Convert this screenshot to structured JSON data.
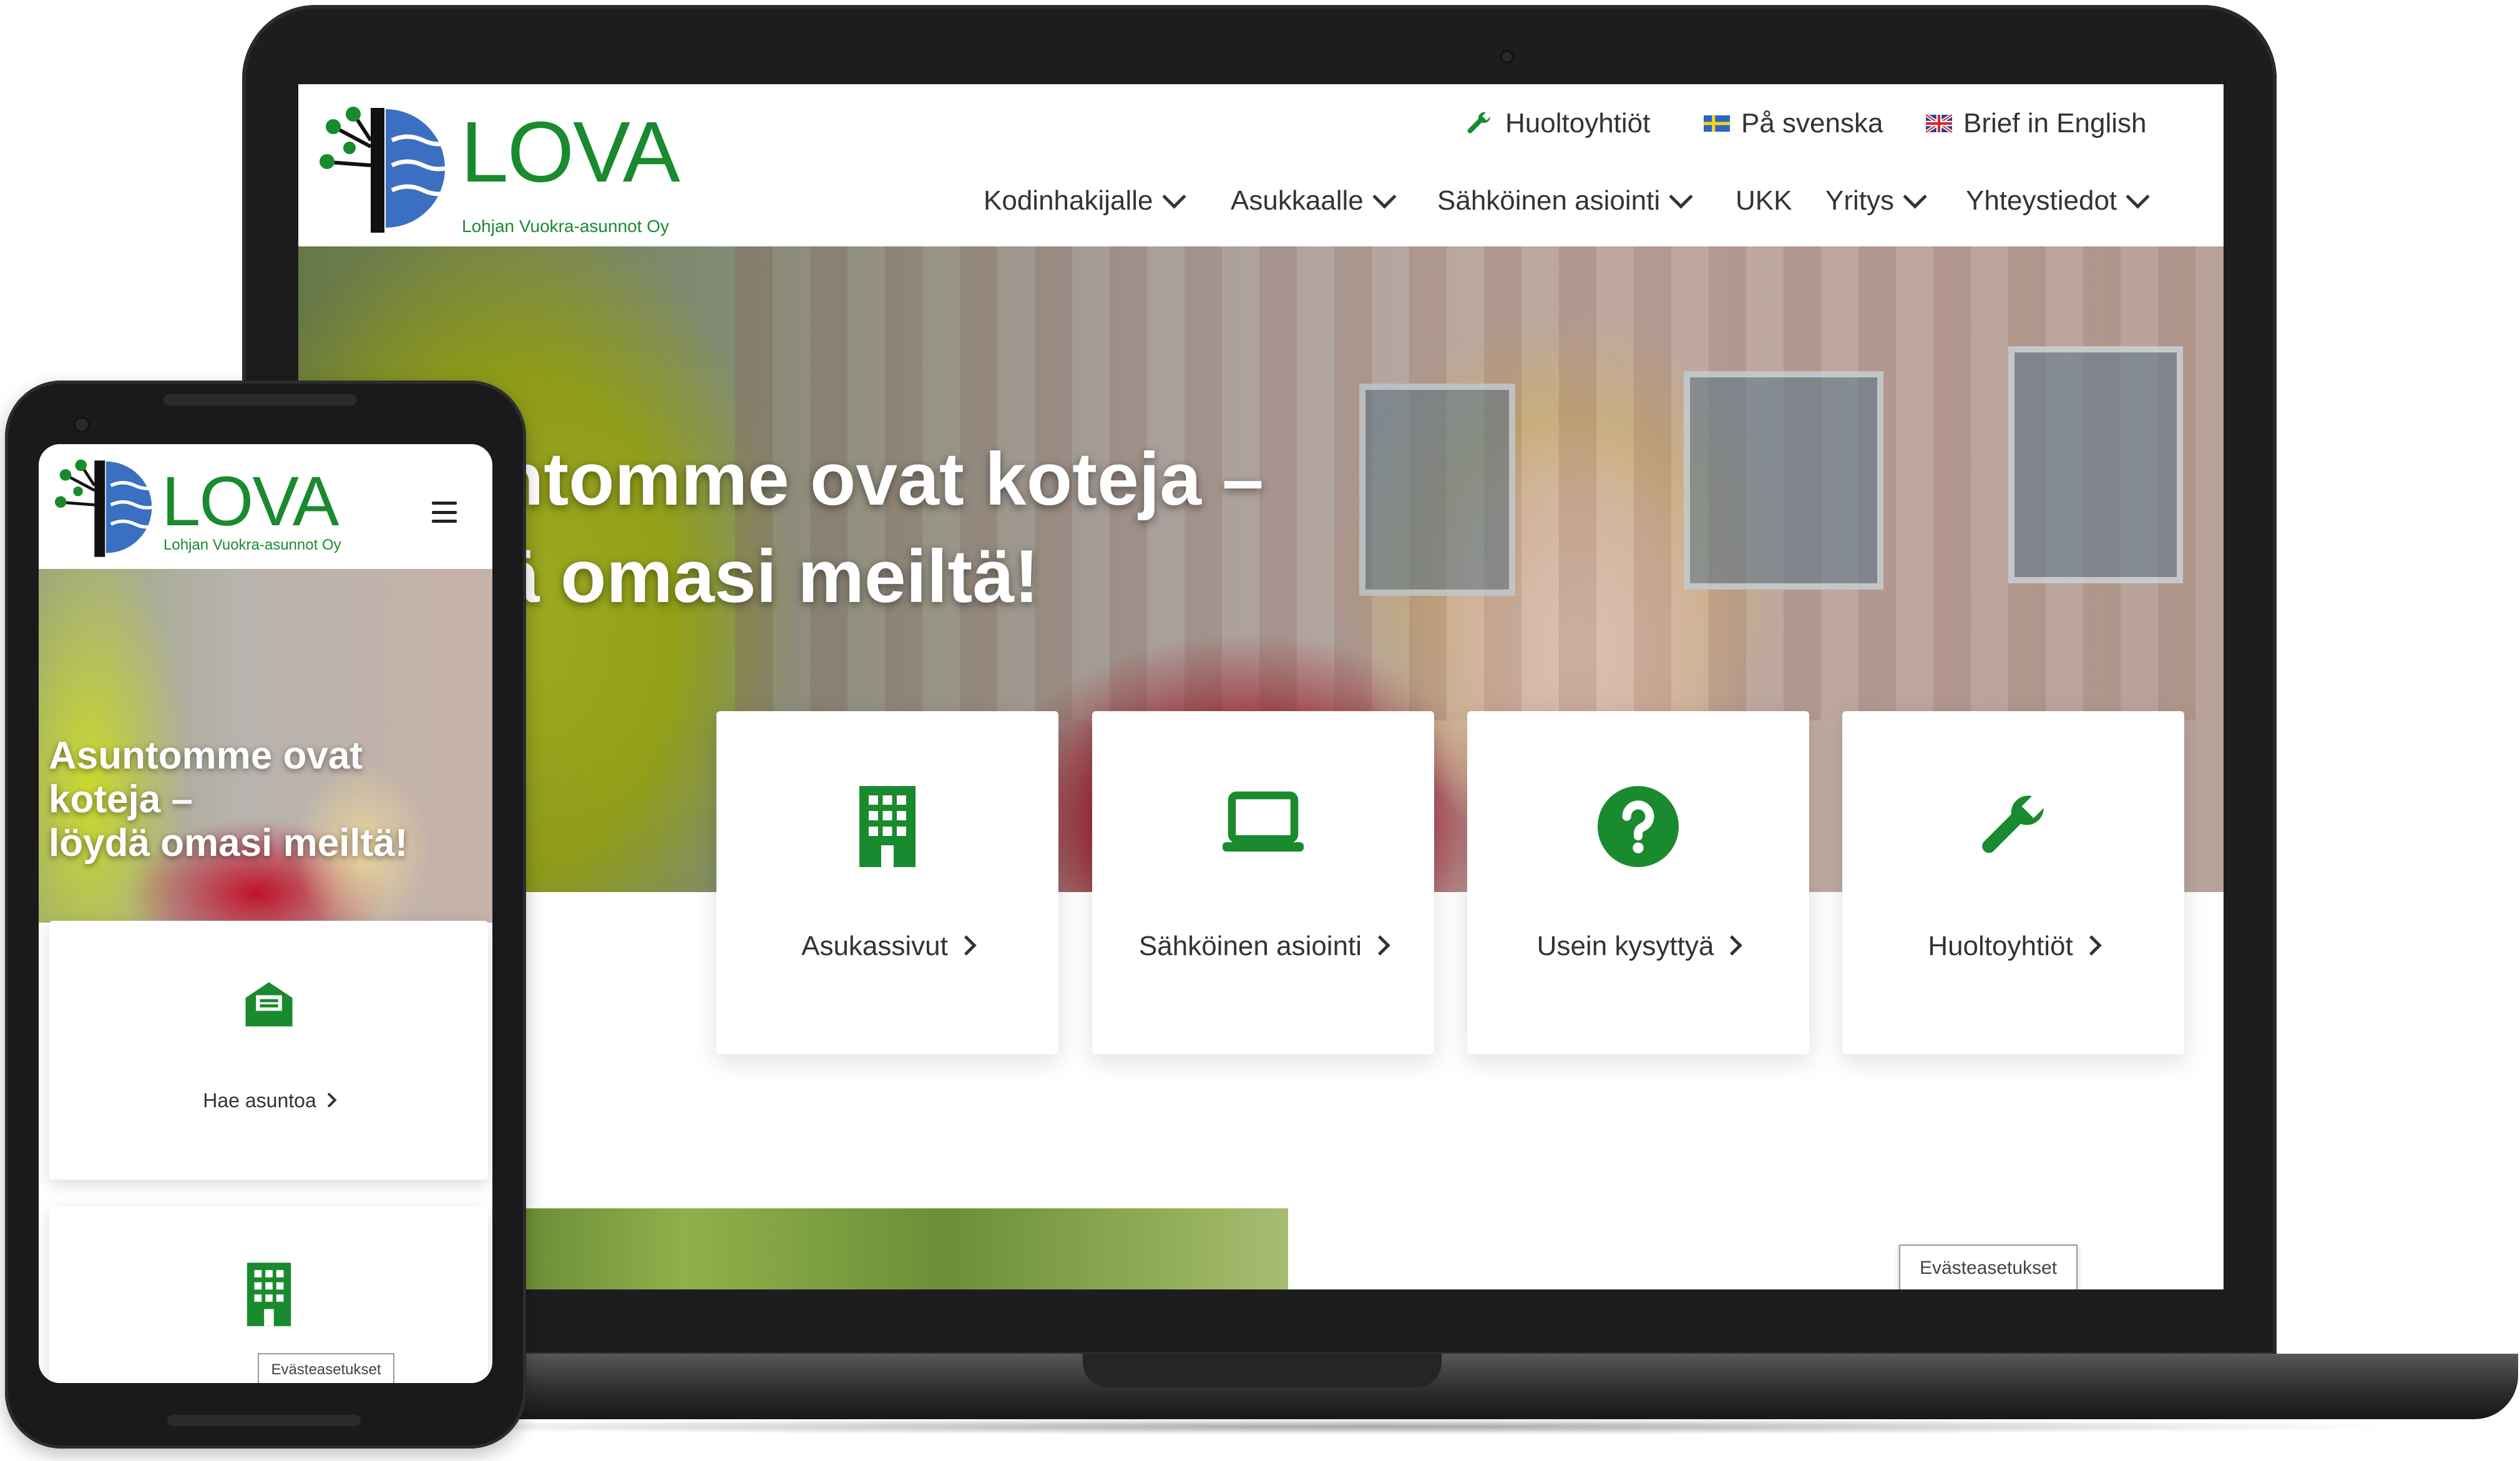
{
  "brand": {
    "name": "LOVA",
    "subtitle": "Lohjan Vuokra-asunnot Oy",
    "green": "#1a8a2e",
    "blue": "#3a6fc1"
  },
  "utility_links": [
    {
      "label": "Huoltoyhtiöt",
      "icon": "wrench-icon"
    },
    {
      "label": "På svenska",
      "icon": "flag-sweden-icon"
    },
    {
      "label": "Brief in English",
      "icon": "flag-uk-icon"
    }
  ],
  "nav": [
    {
      "label": "Kodinhakijalle",
      "dropdown": true
    },
    {
      "label": "Asukkaalle",
      "dropdown": true
    },
    {
      "label": "Sähköinen asiointi",
      "dropdown": true
    },
    {
      "label": "UKK",
      "dropdown": false
    },
    {
      "label": "Yritys",
      "dropdown": true
    },
    {
      "label": "Yhteystiedot",
      "dropdown": true
    }
  ],
  "hero": {
    "line1": "ntomme ovat koteja –",
    "line2": "ä omasi meiltä!"
  },
  "cards": [
    {
      "label": "ntoa",
      "icon": "envelope-icon"
    },
    {
      "label": "Asukassivut",
      "icon": "building-icon"
    },
    {
      "label": "Sähköinen asiointi",
      "icon": "laptop-icon"
    },
    {
      "label": "Usein kysyttyä",
      "icon": "question-circle-icon"
    },
    {
      "label": "Huoltoyhtiöt",
      "icon": "wrench-icon"
    }
  ],
  "cookie_button": "Evästeasetukset",
  "mobile": {
    "hero_title_line1": "Asuntomme ovat",
    "hero_title_line2": "koteja –",
    "hero_title_line3": "löydä omasi meiltä!",
    "cards": [
      {
        "label": "Hae asuntoa",
        "icon": "envelope-icon"
      },
      {
        "label": "",
        "icon": "building-icon"
      }
    ],
    "cookie_button": "Evästeasetukset"
  }
}
